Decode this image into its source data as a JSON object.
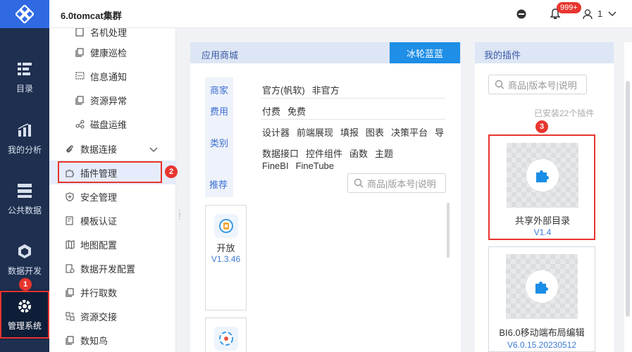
{
  "nav": {
    "items": [
      {
        "label": "目录",
        "icon": "catalog-icon"
      },
      {
        "label": "我的分析",
        "icon": "analysis-icon"
      },
      {
        "label": "公共数据",
        "icon": "public-data-icon"
      },
      {
        "label": "数据开发",
        "icon": "data-dev-icon"
      },
      {
        "label": "管理系统",
        "icon": "manage-system-icon"
      }
    ],
    "badge1": "1"
  },
  "header": {
    "title": "6.0tomcat集群",
    "bell_badge": "999+",
    "user": "1"
  },
  "submenu": {
    "items": [
      {
        "label": "名机处理",
        "type": "child"
      },
      {
        "label": "健康巡检",
        "type": "child"
      },
      {
        "label": "信息通知",
        "type": "child"
      },
      {
        "label": "资源异常",
        "type": "child"
      },
      {
        "label": "磁盘运维",
        "type": "child"
      },
      {
        "label": "数据连接",
        "type": "parent"
      },
      {
        "label": "插件管理",
        "type": "parent"
      },
      {
        "label": "安全管理",
        "type": "parent"
      },
      {
        "label": "模板认证",
        "type": "parent"
      },
      {
        "label": "地图配置",
        "type": "parent"
      },
      {
        "label": "数据开发配置",
        "type": "parent"
      },
      {
        "label": "并行取数",
        "type": "parent"
      },
      {
        "label": "资源交接",
        "type": "parent"
      },
      {
        "label": "数知鸟",
        "type": "parent"
      }
    ],
    "badge2": "2"
  },
  "store": {
    "title": "应用商城",
    "theme_button": "冰轮蓝蓝",
    "tabs": [
      "商家",
      "费用",
      "类别",
      "推荐"
    ],
    "row_vendor": [
      "官方(帆软)",
      "非官方"
    ],
    "row_fee": [
      "付费",
      "免费"
    ],
    "row_cat1": [
      "设计器",
      "前端展现",
      "填报",
      "图表",
      "决策平台",
      "导"
    ],
    "row_cat2": [
      "数据接口",
      "控件组件",
      "函数",
      "主题"
    ],
    "row_cat3": [
      "FineBI",
      "FineTube"
    ],
    "search_placeholder": "商品|版本号|说明",
    "card1_name": "开放",
    "card1_version": "V1.3.46"
  },
  "mine": {
    "title": "我的插件",
    "search_placeholder": "商品|版本号|说明",
    "installed": "已安装22个插件",
    "badge3": "3",
    "plugins": [
      {
        "name": "共享外部目录",
        "version": "V1.4"
      },
      {
        "name": "BI6.0移动端布局编辑",
        "version": "V6.0.15.20230512"
      }
    ]
  },
  "colors": {
    "accent": "#1e8ee6",
    "nav_bg": "#1e2f4f",
    "highlight": "#e8352f"
  }
}
